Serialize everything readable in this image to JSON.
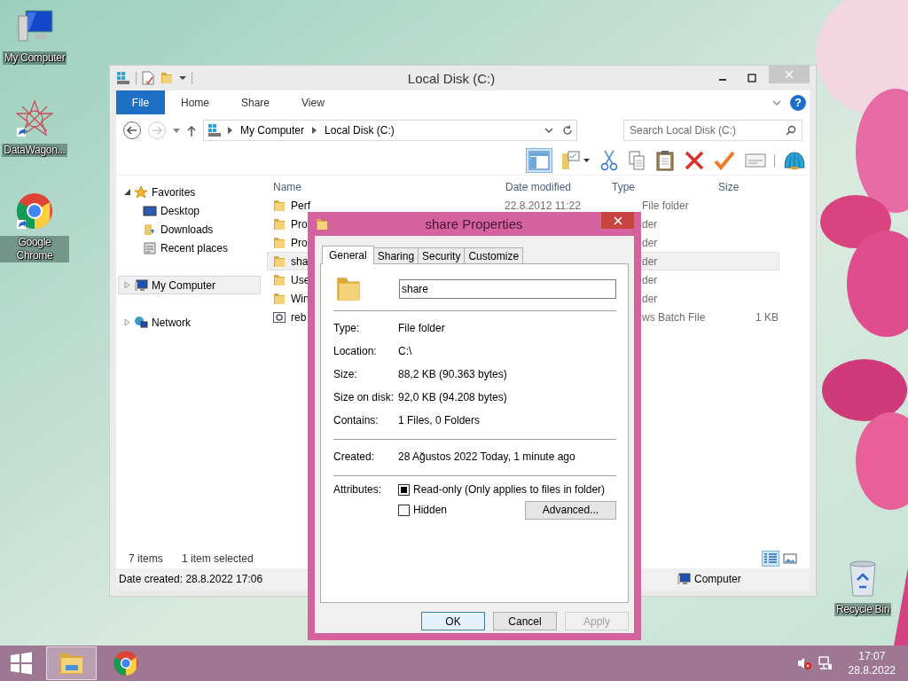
{
  "desktop_icons": [
    {
      "label": "My Computer",
      "kind": "computer"
    },
    {
      "label": "DataWagon...",
      "kind": "star"
    },
    {
      "label": "Google Chrome",
      "kind": "chrome"
    },
    {
      "label": "Recycle Bin",
      "kind": "recycle"
    }
  ],
  "explorer": {
    "title": "Local Disk (C:)",
    "ribbon_tabs": [
      {
        "label": "File",
        "kind": "menu"
      },
      {
        "label": "Home",
        "kind": "tab"
      },
      {
        "label": "Share",
        "kind": "tab"
      },
      {
        "label": "View",
        "kind": "tab"
      }
    ],
    "help": "?",
    "crumbs": [
      "My Computer",
      "Local Disk (C:)"
    ],
    "search": {
      "placeholder": "Search Local Disk (C:)"
    },
    "preview_pane_on": true,
    "nav": [
      {
        "label": "Favorites",
        "kind": "star",
        "expanded": true,
        "selected": false,
        "children": [
          {
            "label": "Desktop",
            "kind": "desktop",
            "selected": false
          },
          {
            "label": "Downloads",
            "kind": "downloads",
            "selected": false
          },
          {
            "label": "Recent places",
            "kind": "recent",
            "selected": false
          }
        ]
      },
      {
        "label": "My Computer",
        "kind": "computer",
        "expanded": false,
        "selected": true
      },
      {
        "label": "Network",
        "kind": "network",
        "expanded": false,
        "selected": false
      }
    ],
    "columns": [
      "Name",
      "Date modified",
      "Type",
      "Size"
    ],
    "rows": [
      {
        "name": "Perf",
        "date": "22.8.2012 11:22",
        "type": "File folder",
        "kind": "folder",
        "selected": false
      },
      {
        "name": "Pro",
        "type": "der",
        "kind": "folder",
        "selected": false
      },
      {
        "name": "Pro",
        "type": "der",
        "kind": "folder",
        "selected": false
      },
      {
        "name": "sha",
        "type": "der",
        "kind": "folder",
        "selected": true
      },
      {
        "name": "Use",
        "type": "der",
        "kind": "folder",
        "selected": false
      },
      {
        "name": "Win",
        "type": "der",
        "kind": "folder",
        "selected": false
      },
      {
        "name": "reb",
        "type": "ws Batch File",
        "size": "1 KB",
        "kind": "batch",
        "selected": false
      }
    ],
    "item_count": "7 items",
    "selection_info": "1 item selected",
    "views": [
      {
        "kind": "details",
        "selected": true
      },
      {
        "kind": "large-icons",
        "selected": false
      }
    ],
    "status_left": "Date created: 28.8.2022 17:06",
    "status_right": "Computer"
  },
  "dialog": {
    "title": "share Properties",
    "tabs": [
      {
        "label": "General",
        "selected": true
      },
      {
        "label": "Sharing",
        "selected": false
      },
      {
        "label": "Security",
        "selected": false
      },
      {
        "label": "Customize",
        "selected": false
      }
    ],
    "name": "share",
    "sections": [
      [
        {
          "label": "Type:",
          "value": "File folder"
        },
        {
          "label": "Location:",
          "value": "C:\\"
        },
        {
          "label": "Size:",
          "value": "88,2 KB (90.363 bytes)"
        },
        {
          "label": "Size on disk:",
          "value": "92,0 KB (94.208 bytes)"
        },
        {
          "label": "Contains:",
          "value": "1 Files, 0 Folders"
        }
      ],
      [
        {
          "label": "Created:",
          "value": "28 Ağustos 2022 Today, 1 minute ago"
        }
      ]
    ],
    "attributes_label": "Attributes:",
    "attributes": [
      {
        "label": "Read-only (Only applies to files in folder)",
        "indeterminate": true
      },
      {
        "label": "Hidden",
        "indeterminate": false
      }
    ],
    "advanced": "Advanced...",
    "buttons": [
      {
        "label": "OK",
        "default": true,
        "disabled": false
      },
      {
        "label": "Cancel",
        "default": false,
        "disabled": false
      },
      {
        "label": "Apply",
        "default": false,
        "disabled": true
      }
    ]
  },
  "taskbar": {
    "apps": [
      {
        "kind": "explorer",
        "selected": true
      },
      {
        "kind": "chrome",
        "selected": false
      }
    ],
    "volume_muted": true,
    "time": "17:07",
    "date": "28.8.2022"
  }
}
